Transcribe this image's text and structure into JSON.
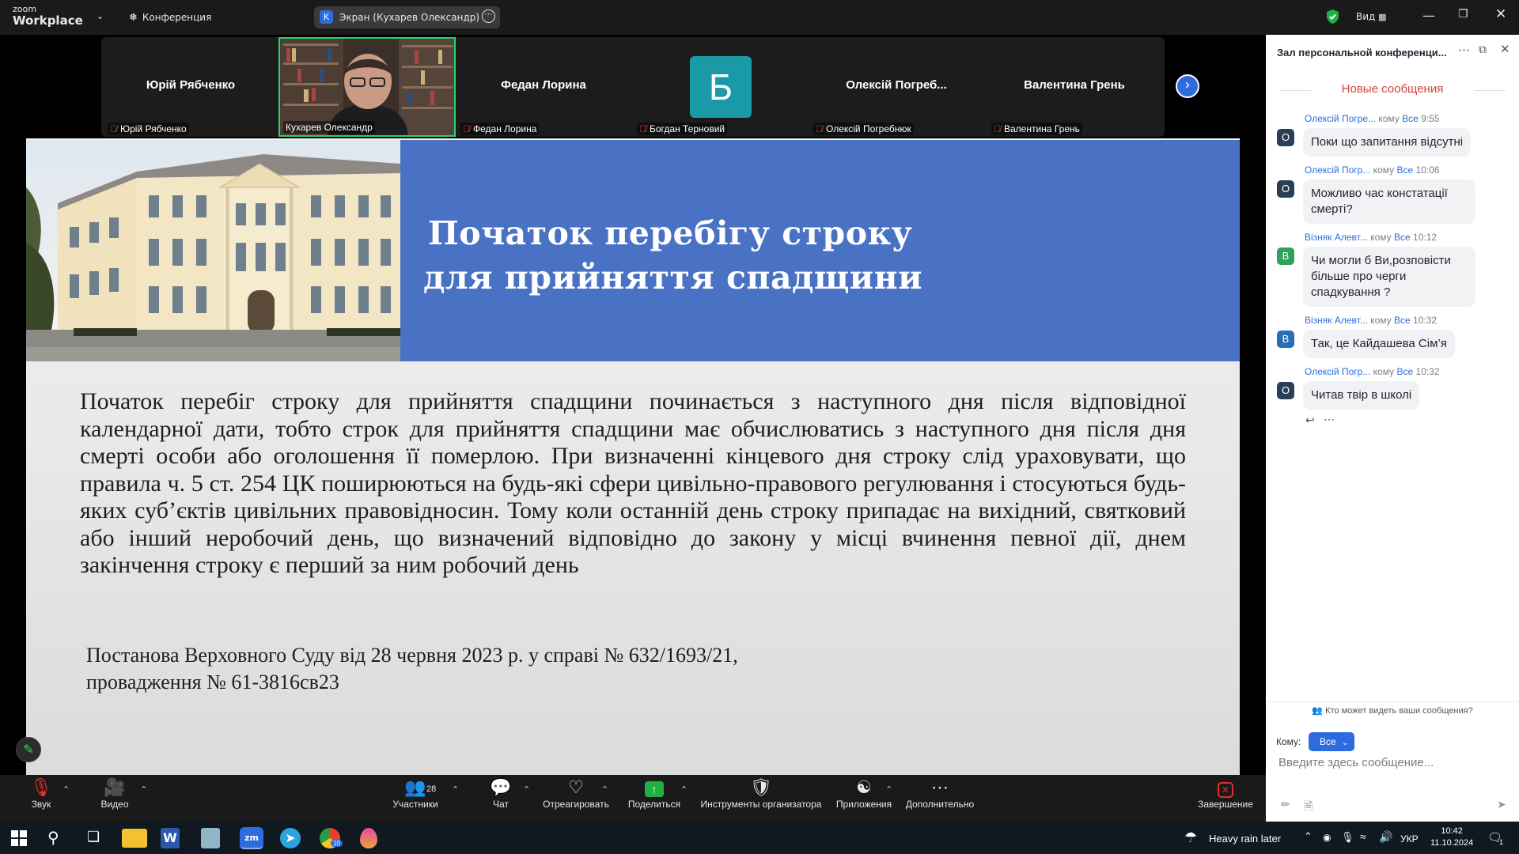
{
  "titlebar": {
    "brand_top": "zoom",
    "brand_bottom": "Workplace",
    "meeting_label": "Конференция",
    "share_initial": "K",
    "share_label": "Экран (Кухарев Олександр)",
    "view_label": "Вид"
  },
  "gallery": {
    "tiles": [
      {
        "name": "Юрій Рябченко",
        "label": "Юрій Рябченко",
        "muted": true
      },
      {
        "name": "",
        "label": "Кухарев Олександр",
        "muted": false,
        "active": true
      },
      {
        "name": "Федан Лорина",
        "label": "Федан Лорина",
        "muted": true
      },
      {
        "name": "Б",
        "label": "Богдан Терновий",
        "muted": true,
        "avatar": true
      },
      {
        "name": "Олексій  Погреб...",
        "label": "Олексій Погребнюк",
        "muted": true
      },
      {
        "name": "Валентина Грень",
        "label": "Валентина Грень",
        "muted": true
      }
    ]
  },
  "slide": {
    "title_line1": "Початок перебігу строку",
    "title_line2": "для прийняття спадщини",
    "body": "Початок перебіг строку для прийняття спадщини починається з наступного дня після відповідної календарної дати, тобто строк для прийняття спадщини має обчислюватись з наступного дня після дня смерті особи або оголошення її померлою. При визначенні кінцевого дня строку слід ураховувати, що правила ч. 5 ст. 254 ЦК поширюються на будь-які сфери цивільно-правового регулювання і стосуються будь-яких суб’єктів цивільних правовідносин. Тому коли останній день строку припадає на вихідний, святковий або інший неробочий день, що визначений відповідно до закону у місці вчинення певної дії, днем закінчення строку є перший за ним робочий день",
    "ref_line1": "Постанова Верховного Суду від 28 червня 2023 р. у справі № 632/1693/21,",
    "ref_line2": "провадження № 61-3816св23"
  },
  "chat": {
    "title": "Зал персональной конференци...",
    "divider": "Новые сообщения",
    "messages": [
      {
        "author": "Олексій Погре...",
        "to_word": "кому",
        "to": "Все",
        "time": "9:55",
        "initial": "O",
        "text": "Поки що запитання відсутні"
      },
      {
        "author": "Олексій Погр...",
        "to_word": "кому",
        "to": "Все",
        "time": "10:06",
        "initial": "O",
        "text": "Можливо час констатації смерті?"
      },
      {
        "author": "Візняк  Алевт...",
        "to_word": "кому",
        "to": "Все",
        "time": "10:12",
        "initial": "B",
        "text": "Чи могли б Ви,розповісти більше про черги спадкування ?"
      },
      {
        "author": "Візняк  Алевт...",
        "to_word": "кому",
        "to": "Все",
        "time": "10:32",
        "initial": "B",
        "text": "Так, це Кайдашева Сім’я"
      },
      {
        "author": "Олексій Погр...",
        "to_word": "кому",
        "to": "Все",
        "time": "10:32",
        "initial": "O",
        "text": "Читав твір в школі"
      }
    ],
    "privacy_note": "Кто может видеть ваши сообщения?",
    "to_label": "Кому:",
    "to_value": "Все",
    "input_placeholder": "Введите здесь сообщение..."
  },
  "toolbar": {
    "audio": "Звук",
    "video": "Видео",
    "participants": "Участники",
    "participants_count": "28",
    "chat": "Чат",
    "react": "Отреагировать",
    "share": "Поделиться",
    "host_tools": "Инструменты организатора",
    "apps": "Приложения",
    "more": "Дополнительно",
    "end": "Завершение"
  },
  "taskbar": {
    "weather": "Heavy rain later",
    "lang": "УКР",
    "time": "10:42",
    "date": "11.10.2024",
    "notif_count": "1",
    "chrome_badge": "10"
  },
  "colors": {
    "accent": "#2d6cdf",
    "slide_banner": "#4a72c4",
    "new_msgs": "#d0453b",
    "share_green": "#1fb141",
    "end_red": "#e02f2f",
    "muted_red": "#e03535"
  }
}
